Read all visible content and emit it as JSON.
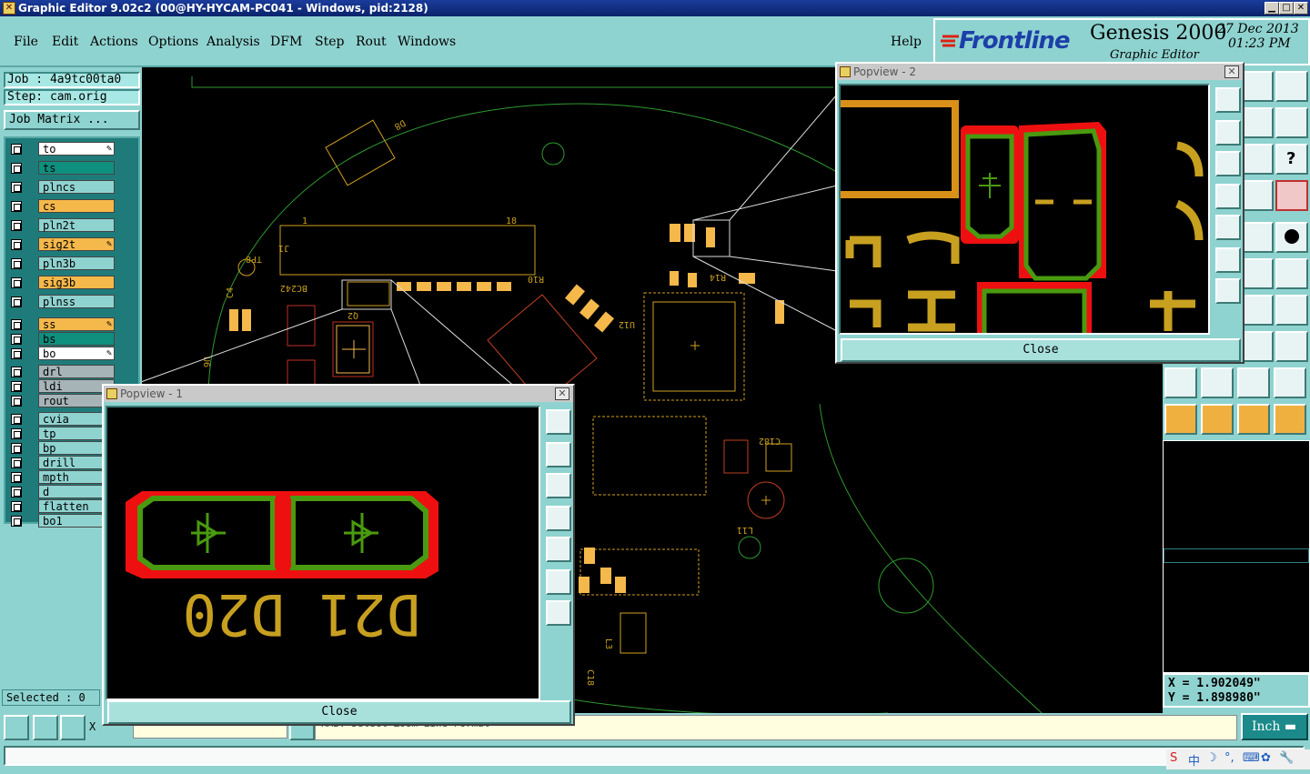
{
  "window": {
    "title": "Graphic Editor 9.02c2 (00@HY-HYCAM-PC041 - Windows, pid:2128)"
  },
  "menu": {
    "items": [
      "File",
      "Edit",
      "Actions",
      "Options",
      "Analysis",
      "DFM",
      "Step",
      "Rout",
      "Windows"
    ],
    "help": "Help"
  },
  "logo": {
    "brand": "Frontline",
    "product": "Genesis 2000",
    "subtitle": "Graphic Editor",
    "date": "27 Dec 2013",
    "time": "01:23 PM"
  },
  "job": {
    "job_label": "Job : 4a9tc00ta0",
    "step_label": "Step: cam.orig",
    "matrix_button": "Job Matrix ..."
  },
  "layers": [
    {
      "name": "to",
      "color": "#ffffff",
      "pen": true
    },
    {
      "name": "ts",
      "color": "#0f8f7e",
      "pen": false
    },
    {
      "name": "plncs",
      "color": "#8fd3d0",
      "pen": false
    },
    {
      "name": "cs",
      "color": "#f5b84a",
      "pen": false
    },
    {
      "name": "pln2t",
      "color": "#8fd3d0",
      "pen": false
    },
    {
      "name": "sig2t",
      "color": "#f5b84a",
      "pen": true
    },
    {
      "name": "pln3b",
      "color": "#8fd3d0",
      "pen": false
    },
    {
      "name": "sig3b",
      "color": "#f5b84a",
      "pen": false
    },
    {
      "name": "plnss",
      "color": "#8fd3d0",
      "pen": false
    },
    {
      "name": "ss",
      "color": "#f5b84a",
      "pen": true
    },
    {
      "name": "bs",
      "color": "#0f8f7e",
      "pen": false
    },
    {
      "name": "bo",
      "color": "#ffffff",
      "pen": true
    },
    {
      "name": "drl",
      "color": "#a6b4b8",
      "pen": false
    },
    {
      "name": "ldi",
      "color": "#a6b4b8",
      "pen": false
    },
    {
      "name": "rout",
      "color": "#a6b4b8",
      "pen": false
    },
    {
      "name": "cvia",
      "color": "#8fd3d0",
      "pen": false
    },
    {
      "name": "tp",
      "color": "#8fd3d0",
      "pen": false
    },
    {
      "name": "bp",
      "color": "#8fd3d0",
      "pen": false
    },
    {
      "name": "drill",
      "color": "#8fd3d0",
      "pen": false
    },
    {
      "name": "mpth",
      "color": "#8fd3d0",
      "pen": false
    },
    {
      "name": "d",
      "color": "#8fd3d0",
      "pen": false
    },
    {
      "name": "flatten",
      "color": "#8fd3d0",
      "pen": false
    },
    {
      "name": "bo1",
      "color": "#8fd3d0",
      "pen": false
    }
  ],
  "status": {
    "selected": "Selected : 0",
    "x_prefix": "X",
    "command_text": "RMB: Select Zoom Line Format",
    "unit": "Inch"
  },
  "coords": {
    "x": "X = 1.902049\"",
    "y": "Y = 1.898980\""
  },
  "popview1": {
    "title": "Popview - 1",
    "close": "Close",
    "label_text": "D21 D20"
  },
  "popview2": {
    "title": "Popview - 2",
    "close": "Close"
  },
  "board_labels": [
    "J1",
    "BC242",
    "Q2",
    "U12",
    "U6",
    "R14",
    "C4",
    "L3",
    "D8",
    "TP8",
    "R10",
    "18",
    "1",
    "L11",
    "C182",
    "C18"
  ],
  "tray": {
    "items": [
      "S",
      "中",
      "☽",
      "°,",
      "⌨",
      "✿",
      "🔧"
    ]
  }
}
